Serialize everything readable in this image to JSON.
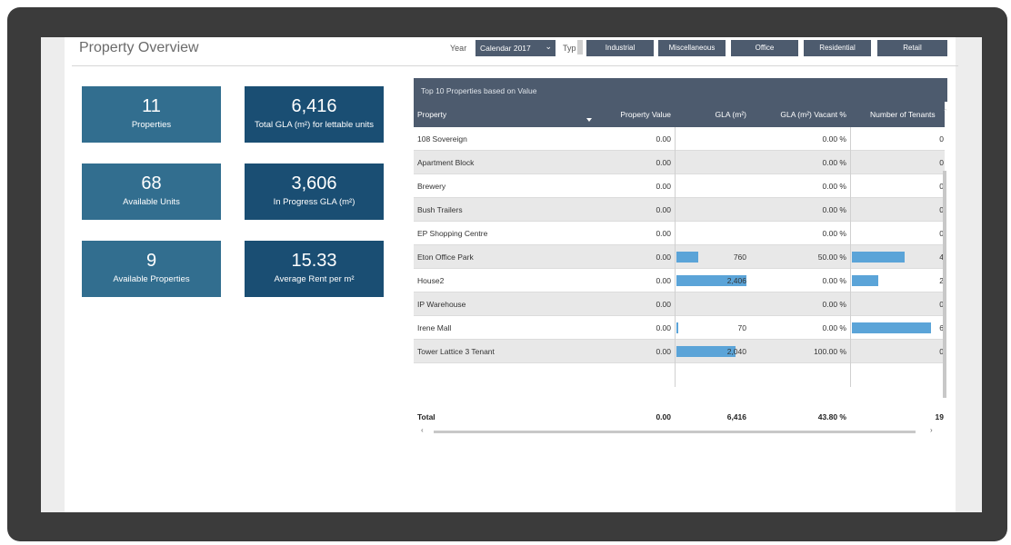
{
  "page": {
    "title": "Property Overview"
  },
  "filters": {
    "year_label": "Year",
    "year_value": "Calendar 2017",
    "type_label": "Typ",
    "types": [
      "Industrial",
      "Miscellaneous",
      "Office",
      "Residential",
      "Retail"
    ]
  },
  "kpis": [
    {
      "value": "11",
      "label": "Properties"
    },
    {
      "value": "6,416",
      "label": "Total GLA (m²) for lettable units"
    },
    {
      "value": "68",
      "label": "Available Units"
    },
    {
      "value": "3,606",
      "label": "In Progress GLA (m²)"
    },
    {
      "value": "9",
      "label": "Available Properties"
    },
    {
      "value": "15.33",
      "label": "Average Rent per m²"
    }
  ],
  "table": {
    "title": "Top 10 Properties based on Value",
    "headers": [
      "Property",
      "Property Value",
      "GLA (m²)",
      "GLA (m²) Vacant %",
      "Number of Tenants"
    ],
    "max_gla": 2406,
    "max_tenants": 6,
    "rows": [
      {
        "property": "108 Sovereign",
        "value": "0.00",
        "gla": "",
        "gla_num": 0,
        "vacant": "0.00 %",
        "tenants": "0"
      },
      {
        "property": "Apartment Block",
        "value": "0.00",
        "gla": "",
        "gla_num": 0,
        "vacant": "0.00 %",
        "tenants": "0"
      },
      {
        "property": "Brewery",
        "value": "0.00",
        "gla": "",
        "gla_num": 0,
        "vacant": "0.00 %",
        "tenants": "0"
      },
      {
        "property": "Bush Trailers",
        "value": "0.00",
        "gla": "",
        "gla_num": 0,
        "vacant": "0.00 %",
        "tenants": "0"
      },
      {
        "property": "EP Shopping Centre",
        "value": "0.00",
        "gla": "",
        "gla_num": 0,
        "vacant": "0.00 %",
        "tenants": "0"
      },
      {
        "property": "Eton Office Park",
        "value": "0.00",
        "gla": "760",
        "gla_num": 760,
        "vacant": "50.00 %",
        "tenants": "4"
      },
      {
        "property": "House2",
        "value": "0.00",
        "gla": "2,406",
        "gla_num": 2406,
        "vacant": "0.00 %",
        "tenants": "2"
      },
      {
        "property": "IP Warehouse",
        "value": "0.00",
        "gla": "",
        "gla_num": 0,
        "vacant": "0.00 %",
        "tenants": "0"
      },
      {
        "property": "Irene Mall",
        "value": "0.00",
        "gla": "70",
        "gla_num": 70,
        "vacant": "0.00 %",
        "tenants": "6"
      },
      {
        "property": "Tower Lattice 3 Tenant",
        "value": "0.00",
        "gla": "2,040",
        "gla_num": 2040,
        "vacant": "100.00 %",
        "tenants": "0"
      }
    ],
    "total": {
      "label": "Total",
      "value": "0.00",
      "gla": "6,416",
      "vacant": "43.80 %",
      "tenants": "19"
    }
  },
  "colors": {
    "header_bg": "#4d5b6e",
    "kpi_light": "#326e8f",
    "kpi_dark": "#1a4e73",
    "bar": "#5ba4d8"
  }
}
